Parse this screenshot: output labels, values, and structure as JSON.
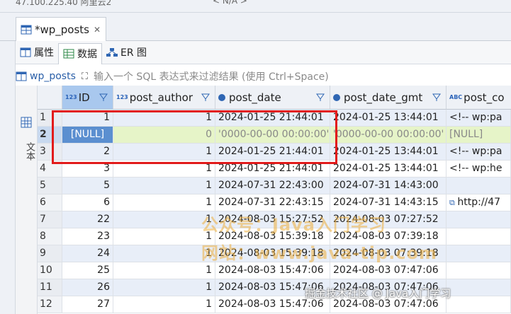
{
  "topbar": {
    "connection": "47.100.225.40 阿里云2",
    "schema": "< N/A >"
  },
  "editor_tab": {
    "label": "*wp_posts"
  },
  "subtabs": [
    {
      "label": "属性"
    },
    {
      "label": "数据"
    },
    {
      "label": "ER 图"
    }
  ],
  "filter": {
    "table": "wp_posts",
    "placeholder": "输入一个 SQL 表达式来过滤结果 (使用 Ctrl+Space)"
  },
  "left_strip": {
    "label": "文本"
  },
  "columns": [
    {
      "name": "ID",
      "type_badge": "123"
    },
    {
      "name": "post_author",
      "type_badge": "123"
    },
    {
      "name": "post_date",
      "type_badge": "date"
    },
    {
      "name": "post_date_gmt",
      "type_badge": "date"
    },
    {
      "name": "post_co",
      "type_badge": "ABC"
    }
  ],
  "rows": [
    {
      "n": "1",
      "id": "1",
      "author": "1",
      "date": "2024-01-25 21:44:01",
      "gmt": "2024-01-25 13:44:01",
      "content": "<!-- wp:pa"
    },
    {
      "n": "2",
      "id": "[NULL]",
      "author": "0",
      "date": "'0000-00-00 00:00:00'",
      "gmt": "'0000-00-00 00:00:00'",
      "content": "[NULL]"
    },
    {
      "n": "3",
      "id": "2",
      "author": "1",
      "date": "2024-01-25 21:44:01",
      "gmt": "2024-01-25 13:44:01",
      "content": "<!-- wp:pa"
    },
    {
      "n": "4",
      "id": "3",
      "author": "1",
      "date": "2024-01-25 21:44:01",
      "gmt": "2024-01-25 13:44:01",
      "content": "<!-- wp:he"
    },
    {
      "n": "5",
      "id": "5",
      "author": "1",
      "date": "2024-07-31 22:43:00",
      "gmt": "2024-07-31 14:43:00",
      "content": ""
    },
    {
      "n": "6",
      "id": "6",
      "author": "1",
      "date": "2024-07-31 22:43:15",
      "gmt": "2024-07-31 14:43:15",
      "content": "http://47"
    },
    {
      "n": "7",
      "id": "22",
      "author": "1",
      "date": "2024-08-03 15:27:52",
      "gmt": "2024-08-03 07:27:52",
      "content": ""
    },
    {
      "n": "8",
      "id": "23",
      "author": "1",
      "date": "2024-08-03 15:39:18",
      "gmt": "2024-08-03 07:39:18",
      "content": ""
    },
    {
      "n": "9",
      "id": "24",
      "author": "1",
      "date": "2024-08-03 15:39:18",
      "gmt": "2024-08-03 07:39:18",
      "content": ""
    },
    {
      "n": "10",
      "id": "25",
      "author": "1",
      "date": "2024-08-03 15:47:06",
      "gmt": "2024-08-03 07:47:06",
      "content": ""
    },
    {
      "n": "11",
      "id": "26",
      "author": "1",
      "date": "2024-08-03 15:47:06",
      "gmt": "2024-08-03 07:47:06",
      "content": ""
    },
    {
      "n": "12",
      "id": "27",
      "author": "1",
      "date": "2024-08-03 15:47:06",
      "gmt": "2024-08-03 07:47:06",
      "content": ""
    }
  ],
  "watermarks": {
    "line1": "公众号：Java入门学习",
    "line2": "网站：www.java-tip.com",
    "footer": "掘金技术社区 @ Java入门学习"
  },
  "colors": {
    "highlight_box": "#e21b1b",
    "new_row": "#e6f4c8",
    "selected_header": "#a9c8ee"
  }
}
